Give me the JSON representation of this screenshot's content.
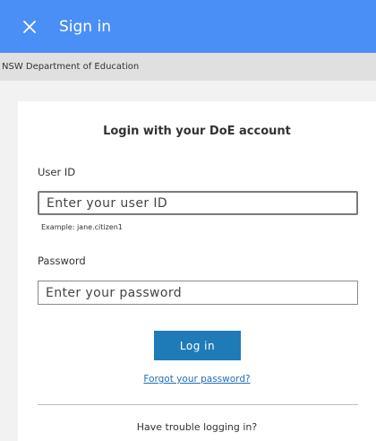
{
  "appbar": {
    "title": "Sign in",
    "background": "#4a8ff5",
    "close_icon": "close-icon"
  },
  "org": {
    "name": "NSW Department of Education"
  },
  "login": {
    "heading": "Login with your DoE account",
    "user_id_label": "User ID",
    "user_id_placeholder": "Enter your user ID",
    "user_id_value": "",
    "user_id_hint": "Example: jane.citizen1",
    "password_label": "Password",
    "password_placeholder": "Enter your password",
    "password_value": "",
    "submit_label": "Log in",
    "submit_color": "#1f7ab8",
    "forgot_link": "Forgot your password?",
    "trouble_text": "Have trouble logging in?"
  }
}
